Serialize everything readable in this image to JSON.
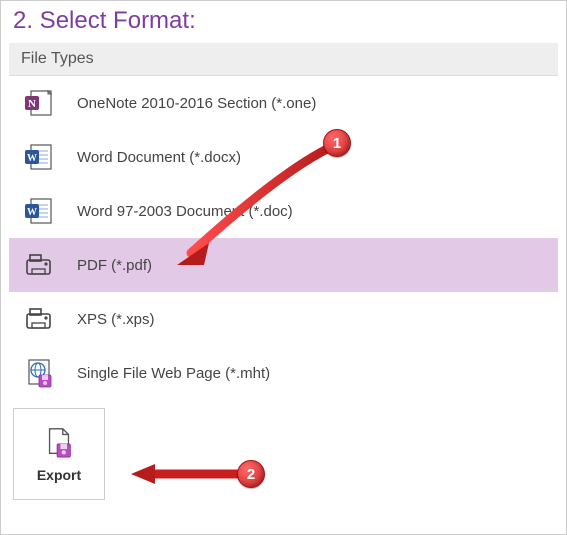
{
  "section": {
    "title": "2. Select Format:",
    "header": "File Types"
  },
  "file_types": [
    {
      "icon": "onenote-icon",
      "label": "OneNote 2010-2016 Section (*.one)",
      "selected": false
    },
    {
      "icon": "word-docx-icon",
      "label": "Word Document (*.docx)",
      "selected": false
    },
    {
      "icon": "word-doc-icon",
      "label": "Word 97-2003 Document (*.doc)",
      "selected": false
    },
    {
      "icon": "pdf-icon",
      "label": "PDF (*.pdf)",
      "selected": true
    },
    {
      "icon": "xps-icon",
      "label": "XPS (*.xps)",
      "selected": false
    },
    {
      "icon": "mht-icon",
      "label": "Single File Web Page (*.mht)",
      "selected": false
    }
  ],
  "export": {
    "label": "Export"
  },
  "annotations": {
    "marker1": "1",
    "marker2": "2"
  },
  "colors": {
    "accent": "#7e3ea0",
    "selected_row": "#e2c9e6",
    "badge": "#c81e1e"
  }
}
